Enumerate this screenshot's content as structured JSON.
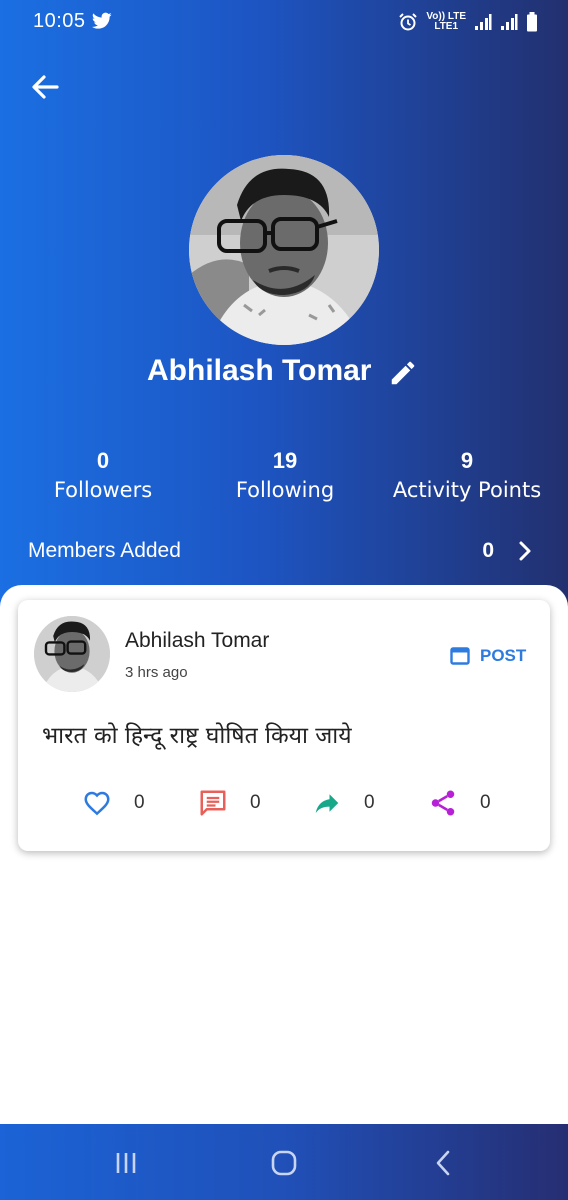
{
  "status_bar": {
    "time": "10:05",
    "notification_icon": "twitter-icon",
    "indicators": [
      "alarm-icon",
      "volte-lte-icon",
      "signal-icon",
      "signal-icon",
      "battery-icon"
    ],
    "volte_text": "Vo)) LTE",
    "lte_text": "LTE1"
  },
  "profile": {
    "name": "Abhilash Tomar",
    "stats": [
      {
        "value": "0",
        "label": "Followers"
      },
      {
        "value": "19",
        "label": "Following"
      },
      {
        "value": "9",
        "label": "Activity Points"
      }
    ],
    "members_added": {
      "label": "Members Added",
      "count": "0"
    }
  },
  "post": {
    "author": "Abhilash Tomar",
    "time": "3 hrs ago",
    "type_label": "POST",
    "text": "भारत को हिन्दू राष्ट्र घोषित किया जाये",
    "actions": [
      {
        "icon": "heart-icon",
        "count": "0",
        "color": "#2e7be0"
      },
      {
        "icon": "comment-icon",
        "count": "0",
        "color": "#e8605a"
      },
      {
        "icon": "share-arrow-icon",
        "count": "0",
        "color": "#17a88a"
      },
      {
        "icon": "share-icon",
        "count": "0",
        "color": "#b620d6"
      }
    ]
  },
  "colors": {
    "gradient_start": "#1b6fe2",
    "gradient_end": "#22306f",
    "accent_blue": "#2e7be0"
  }
}
